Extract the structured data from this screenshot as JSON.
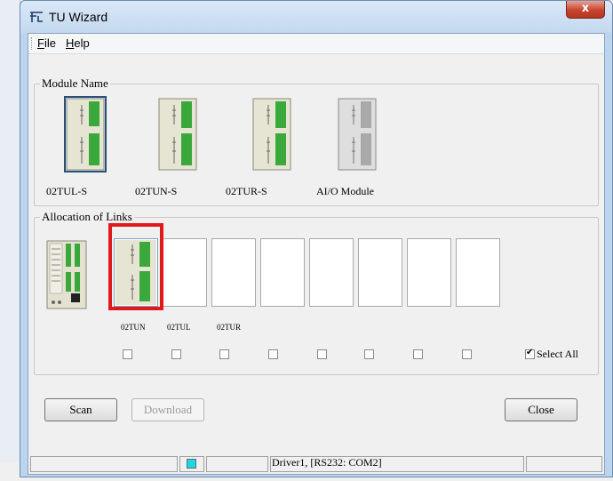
{
  "window": {
    "title": "TU Wizard",
    "close_glyph": "x"
  },
  "menu": [
    {
      "accel": "F",
      "rest": "ile"
    },
    {
      "accel": "H",
      "rest": "elp"
    }
  ],
  "module_name_group": {
    "label": "Module Name",
    "modules": [
      {
        "label": "02TUL-S",
        "selected": true
      },
      {
        "label": "02TUN-S",
        "selected": false
      },
      {
        "label": "02TUR-S",
        "selected": false
      },
      {
        "label": "AI/O Module",
        "selected": false
      }
    ]
  },
  "allocation_group": {
    "label": "Allocation of Links",
    "slot_labels": [
      "02TUN",
      "02TUL",
      "02TUR"
    ],
    "slot_count": 8,
    "select_all_label": "Select All",
    "select_all_checked": true
  },
  "buttons": {
    "scan": "Scan",
    "download": "Download",
    "close": "Close"
  },
  "statusbar": {
    "driver_text": "Driver1, [RS232: COM2]",
    "led_color": "#1ad8e6"
  },
  "colors": {
    "highlight": "#e0191c",
    "module_green": "#3aa83a"
  }
}
